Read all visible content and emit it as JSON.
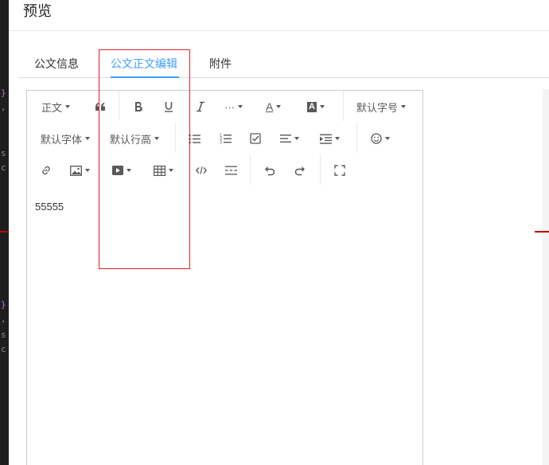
{
  "modal": {
    "title": "预览"
  },
  "tabs": [
    {
      "label": "公文信息",
      "active": false
    },
    {
      "label": "公文正文编辑",
      "active": true
    },
    {
      "label": "附件",
      "active": false
    }
  ],
  "toolbar": {
    "row1": {
      "paragraph_label": "正文",
      "more_label": "···",
      "font_color_label": "A",
      "bg_color_label": "A",
      "font_size_label": "默认字号"
    },
    "row2": {
      "font_family_label": "默认字体",
      "line_height_label": "默认行高"
    }
  },
  "editor": {
    "content": "55555"
  },
  "colors": {
    "accent": "#409eff",
    "highlight_box": "#e02020",
    "code_purple": "#b66fd1"
  },
  "icons": [
    "quote-icon",
    "bold-icon",
    "underline-icon",
    "italic-icon",
    "more-icon",
    "font-color-icon",
    "background-color-icon",
    "bulleted-list-icon",
    "numbered-list-icon",
    "todo-icon",
    "justify-icon",
    "indent-icon",
    "emotion-icon",
    "link-icon",
    "image-icon",
    "video-icon",
    "table-icon",
    "code-icon",
    "divider-icon",
    "undo-icon",
    "redo-icon",
    "fullscreen-icon"
  ]
}
